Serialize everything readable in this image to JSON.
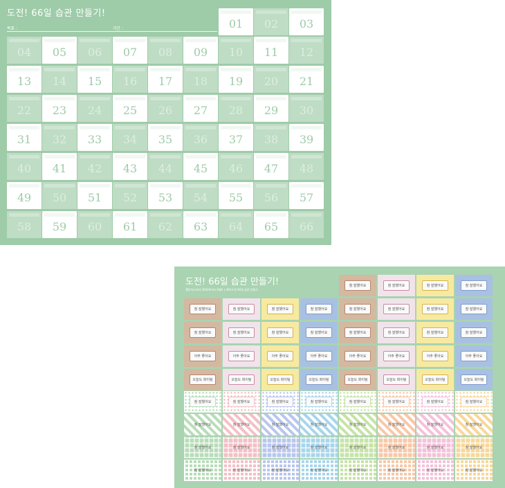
{
  "top_board": {
    "title": "도전! 66일 습관 만들기!",
    "goal_label": "목표 :",
    "period_label": "기간 :",
    "numbers": [
      "01",
      "02",
      "03",
      "04",
      "05",
      "06",
      "07",
      "08",
      "09",
      "10",
      "11",
      "12",
      "13",
      "14",
      "15",
      "16",
      "17",
      "18",
      "19",
      "20",
      "21",
      "22",
      "23",
      "24",
      "25",
      "26",
      "27",
      "28",
      "29",
      "30",
      "31",
      "32",
      "33",
      "34",
      "35",
      "36",
      "37",
      "38",
      "39",
      "40",
      "41",
      "42",
      "43",
      "44",
      "45",
      "46",
      "47",
      "48",
      "49",
      "50",
      "51",
      "52",
      "53",
      "54",
      "55",
      "56",
      "57",
      "58",
      "59",
      "60",
      "61",
      "62",
      "63",
      "64",
      "65",
      "66"
    ]
  },
  "sticker_sheet": {
    "title": "도전! 66일 습관 만들기!",
    "subtitle": "챌린지스티커 20X20mm 6매A | (90)도전 66일 습관 만들기",
    "text_great": "참 잘했어요",
    "text_good": "아주 좋아요",
    "text_cheer": "오늘도 화이팅"
  },
  "colors": {
    "board_green": "#9ecba8",
    "cell_green": "#bfdcc5",
    "sheet_green": "#a9d3b1",
    "brown": "#d4b8a0",
    "pink": "#f0e4ea",
    "yellow": "#f7eaa0",
    "blue": "#a8c1e2"
  }
}
